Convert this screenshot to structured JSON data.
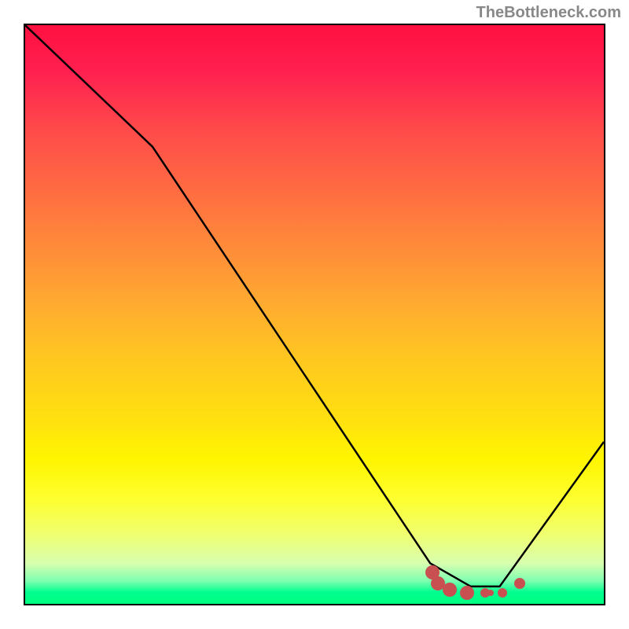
{
  "watermark": "TheBottleneck.com",
  "chart_data": {
    "type": "line",
    "title": "",
    "xlabel": "",
    "ylabel": "",
    "xlim": [
      0,
      100
    ],
    "ylim": [
      0,
      100
    ],
    "curve": [
      {
        "x": 0,
        "y": 100
      },
      {
        "x": 22,
        "y": 79
      },
      {
        "x": 70,
        "y": 7
      },
      {
        "x": 77,
        "y": 3
      },
      {
        "x": 82,
        "y": 3
      },
      {
        "x": 100,
        "y": 28
      }
    ],
    "markers": [
      {
        "x": 70,
        "y": 6,
        "size": 18
      },
      {
        "x": 71,
        "y": 4,
        "size": 18
      },
      {
        "x": 73,
        "y": 3,
        "size": 18
      },
      {
        "x": 76,
        "y": 2.5,
        "size": 18
      },
      {
        "x": 79,
        "y": 2.5,
        "size": 12
      },
      {
        "x": 80,
        "y": 2.5,
        "size": 8
      },
      {
        "x": 82,
        "y": 2.5,
        "size": 12
      },
      {
        "x": 85,
        "y": 4,
        "size": 14
      }
    ],
    "marker_color": "#c85050"
  }
}
